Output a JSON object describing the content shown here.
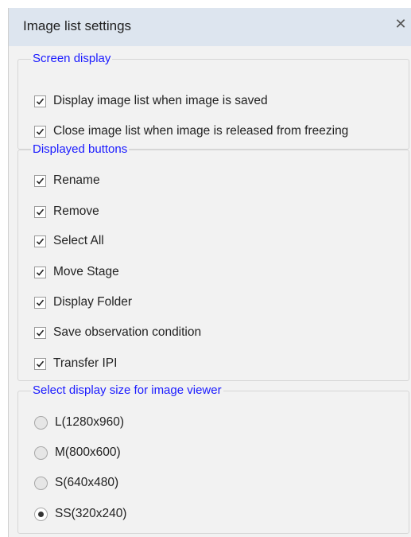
{
  "window": {
    "title": "Image list settings",
    "close_glyph": "✕"
  },
  "screen_display": {
    "legend": "Screen display",
    "items": [
      {
        "label": "Display image list when image is saved",
        "checked": true
      },
      {
        "label": "Close image list when image is released from freezing",
        "checked": true
      }
    ]
  },
  "displayed_buttons": {
    "legend": "Displayed buttons",
    "items": [
      {
        "label": "Rename",
        "checked": true
      },
      {
        "label": "Remove",
        "checked": true
      },
      {
        "label": "Select All",
        "checked": true
      },
      {
        "label": "Move Stage",
        "checked": true
      },
      {
        "label": "Display Folder",
        "checked": true
      },
      {
        "label": "Save observation condition",
        "checked": true
      },
      {
        "label": "Transfer IPI",
        "checked": true
      }
    ]
  },
  "display_size": {
    "legend": "Select display size for image viewer",
    "options": [
      {
        "label": "L(1280x960)",
        "selected": false
      },
      {
        "label": "M(800x600)",
        "selected": false
      },
      {
        "label": "S(640x480)",
        "selected": false
      },
      {
        "label": "SS(320x240)",
        "selected": true
      }
    ]
  },
  "colors": {
    "legend_text": "#1a1aff",
    "titlebar_bg": "#dde5ef",
    "dialog_bg": "#f2f2f2"
  }
}
